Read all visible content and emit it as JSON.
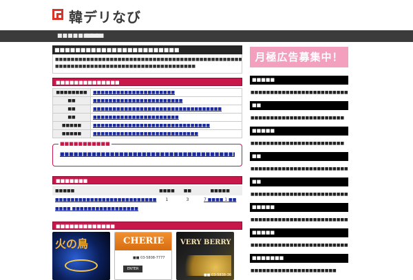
{
  "header": {
    "logo_text": "韓デリなび"
  },
  "nav": {
    "items": [
      "■■■■■■■■■",
      "■■■"
    ]
  },
  "main": {
    "page_title": "■■■■■■■■■■■■■■■■■■■■■■■■",
    "intro": "■■■■■■■■■■■■■■■■■■■■■■■■■■■■■■■■■■■■■■■■■■■■■■■■■■■■■■■■■■■■■■■■■■■■■■■■ ■■■■■■■■■■■■■■■■■■■■■■■■■■■■■■■■■■■■",
    "info_title": "■■■■■■■■■■■■■■",
    "info_rows": [
      {
        "label": "■■■■■■■■",
        "value": "■■■■■■■■■■■■■■■■■■■■■"
      },
      {
        "label": "■■",
        "value": "■■■■■■■■■■■■■■■■■■■■■■■"
      },
      {
        "label": "■■",
        "value": "■■■■■■■■■■■■■■■■■■■■■■■■■■■■■■■■■"
      },
      {
        "label": "■■",
        "value": "■■■■■■■■■■■■■■■■■■■■■■"
      },
      {
        "label": "■■■■■",
        "value": "■■■■■■■■■■■■■■■■■■■■■■■■■■■■■■"
      },
      {
        "label": "■■■■■",
        "value": "■■■■■■■■■■■■■■■■■■■■■■■■■■■"
      }
    ],
    "pickup_legend": "■■■■■■■■■■■",
    "pickup_text": "■■■■■■■■■■■■■■■■■■■■■■■■■■■■■■■■■■■■■■■■■■■■■■■■",
    "ranking_title": "■■■■■■■",
    "ranking_headers": [
      "■■■■■",
      "■■■■",
      "■■",
      "■■■■■"
    ],
    "ranking_rows": [
      {
        "name": "■■■■■■■■■■■■■■■■■■■■■■■■■■",
        "c1": "1",
        "c2": "3",
        "c3": "7 ■■■■ 1 ■■"
      },
      {
        "name": "■■■■  ■■■■■■■■■■■■■■■■■",
        "c1": "",
        "c2": "",
        "c3": ""
      }
    ],
    "banners_title": "■■■■■■■■■■■■■",
    "banners": [
      {
        "title": "火の鳥"
      },
      {
        "title": "CHERIE",
        "tel": "■■ 03-5808-7777",
        "enter": "ENTER"
      },
      {
        "title": "VERY BERRY",
        "tel": "■■ 03-5838-36"
      }
    ]
  },
  "sidebar": {
    "ad_text": "月極広告募集中！",
    "sections": [
      {
        "head": "■■■■■",
        "link": "■■■■■■■■■■■■■■■■■■■■■■■■■■■■■"
      },
      {
        "head": "■■",
        "link": "■■■■■■■■■■■■■■■■■■■■■■■■"
      },
      {
        "head": "■■■■■",
        "link": "■■■■■■■■■■■■■■■■■■■■■■■■"
      },
      {
        "head": "■■",
        "link": "■■■■■■■■■■■■■■■■■■■■■■■■■■■■■■■■■■■■■"
      },
      {
        "head": "■■",
        "link": "■■■■■■■■■■■■■■■■■■■■■■■■■"
      },
      {
        "head": "■■■■■",
        "link": "■■■■■■■■■■■■■■■■■■■■■■■■■■■■■■■■■"
      },
      {
        "head": "■■■■■",
        "link": "■■■■■■■■■■■■■■■■■■■■■■■■■■■■■■■"
      },
      {
        "head": "■■■■■■■",
        "link": "■■■■■■■■■■■■■■■■■■■■■■"
      }
    ]
  },
  "colors": {
    "accent": "#c8174a",
    "nav_bg": "#3b3b3b",
    "ad_bg": "#f2a0bd",
    "logo_red": "#d8342a"
  }
}
